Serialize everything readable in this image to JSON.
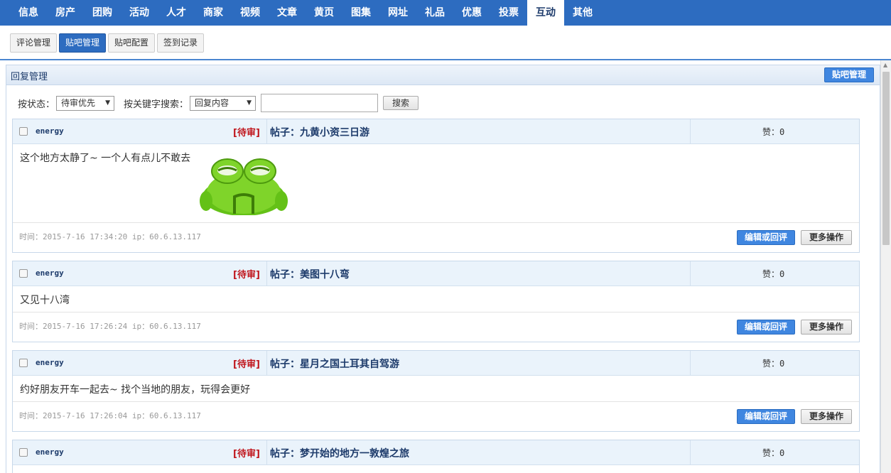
{
  "topnav": [
    {
      "label": "信息"
    },
    {
      "label": "房产"
    },
    {
      "label": "团购"
    },
    {
      "label": "活动"
    },
    {
      "label": "人才"
    },
    {
      "label": "商家"
    },
    {
      "label": "视频"
    },
    {
      "label": "文章"
    },
    {
      "label": "黄页"
    },
    {
      "label": "图集"
    },
    {
      "label": "网址"
    },
    {
      "label": "礼品"
    },
    {
      "label": "优惠"
    },
    {
      "label": "投票"
    },
    {
      "label": "互动",
      "active": true
    },
    {
      "label": "其他"
    }
  ],
  "subnav": [
    {
      "label": "评论管理"
    },
    {
      "label": "贴吧管理",
      "active": true
    },
    {
      "label": "贴吧配置"
    },
    {
      "label": "签到记录"
    }
  ],
  "panel": {
    "title": "回复管理",
    "button": "贴吧管理"
  },
  "filter": {
    "status_label": "按状态：",
    "status_value": "待审优先",
    "keyword_label": "按关键字搜索：",
    "keyword_field": "回复内容",
    "search_value": "",
    "search_button": "搜索"
  },
  "replies": [
    {
      "user": "energy",
      "status": "[待审]",
      "post": "帖子：九黄小资三日游",
      "likes": "赞：0",
      "content": "这个地方太静了~ 一个人有点儿不敢去",
      "meta": "时间：2015-7-16 17:34:20  ip：60.6.13.117"
    },
    {
      "user": "energy",
      "status": "[待审]",
      "post": "帖子：美图十八弯",
      "likes": "赞：0",
      "content": "又见十八湾",
      "meta": "时间：2015-7-16 17:26:24  ip：60.6.13.117"
    },
    {
      "user": "energy",
      "status": "[待审]",
      "post": "帖子：星月之国土耳其自驾游",
      "likes": "赞：0",
      "content": "约好朋友开车一起去~ 找个当地的朋友，玩得会更好",
      "meta": "时间：2015-7-16 17:26:04  ip：60.6.13.117"
    },
    {
      "user": "energy",
      "status": "[待审]",
      "post": "帖子：梦开始的地方一敦煌之旅",
      "likes": "赞：0",
      "content": "",
      "meta": ""
    }
  ],
  "actions": {
    "edit": "编辑或回评",
    "more": "更多操作"
  },
  "colors": {
    "nav": "#2d6cc0",
    "status": "#c0161d",
    "primary": "#3f86e0"
  }
}
